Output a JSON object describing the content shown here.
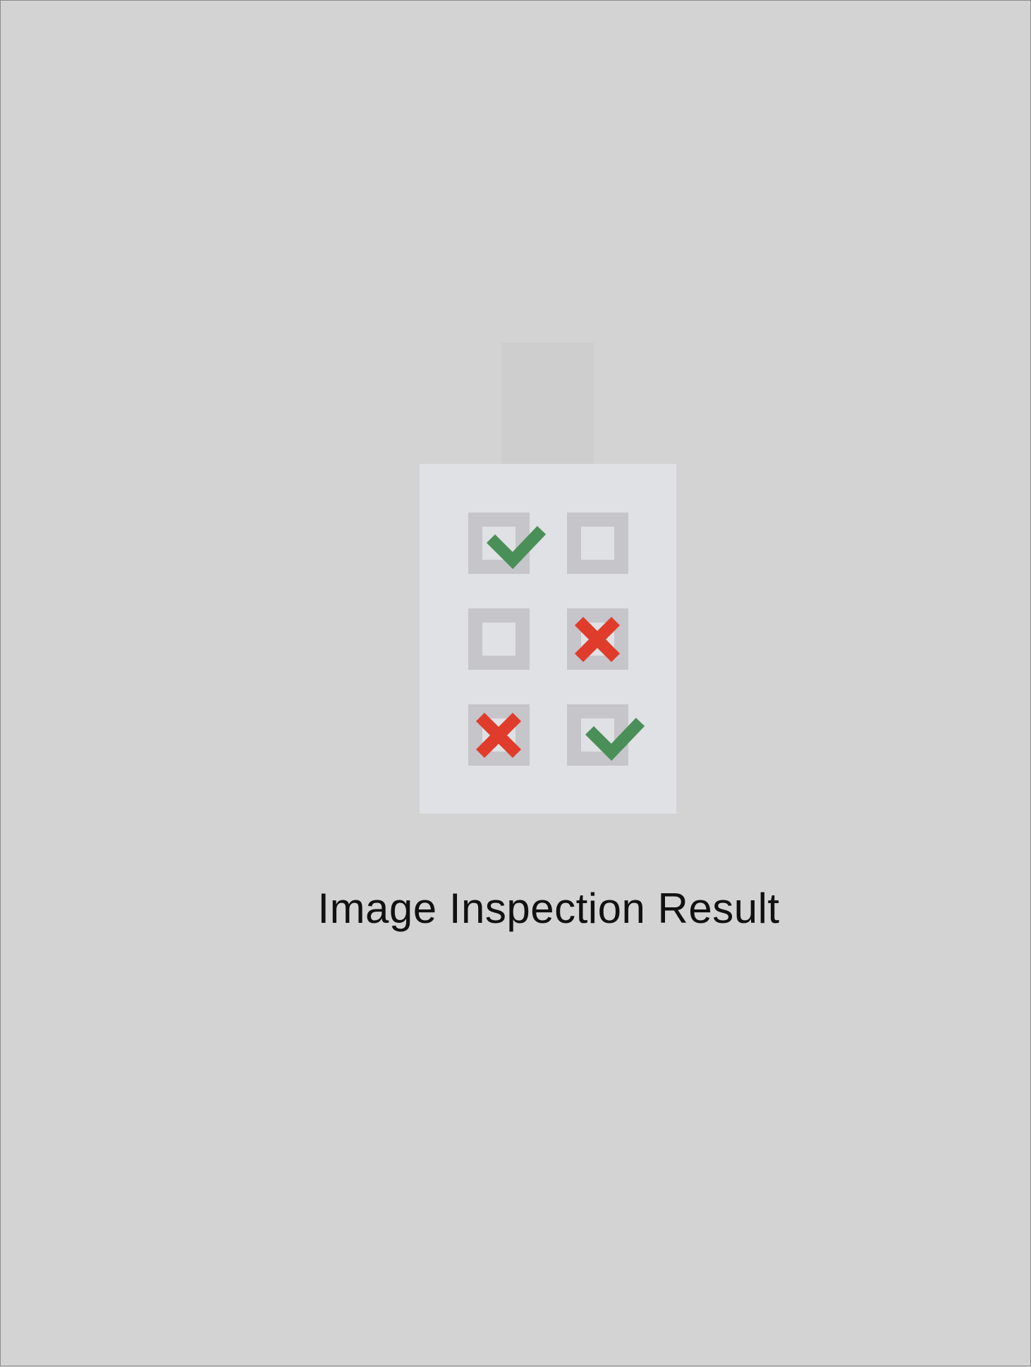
{
  "title": "Image Inspection Result",
  "checklist": {
    "rows": [
      [
        "check",
        "empty"
      ],
      [
        "empty",
        "cross"
      ],
      [
        "cross",
        "check"
      ]
    ]
  },
  "colors": {
    "background": "#d3d3d3",
    "card": "#e0e1e4",
    "box": "#c5c5ca",
    "check": "#4a8f58",
    "cross": "#e03c2b"
  }
}
